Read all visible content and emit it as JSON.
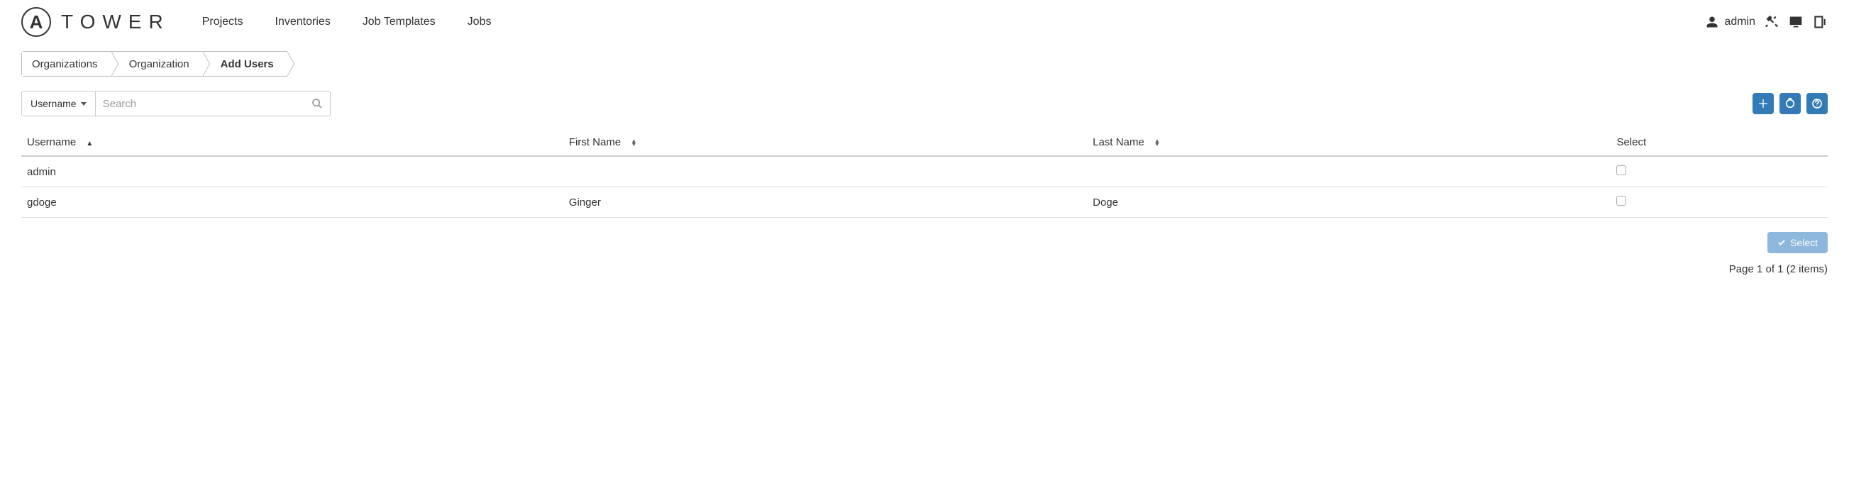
{
  "brand": {
    "logo_letter": "A",
    "name": "TOWER"
  },
  "nav": {
    "projects": "Projects",
    "inventories": "Inventories",
    "job_templates": "Job Templates",
    "jobs": "Jobs"
  },
  "user": {
    "name": "admin"
  },
  "breadcrumb": {
    "items": [
      "Organizations",
      "Organization",
      "Add Users"
    ]
  },
  "search": {
    "type_label": "Username",
    "placeholder": "Search"
  },
  "columns": {
    "username": "Username",
    "first_name": "First Name",
    "last_name": "Last Name",
    "select": "Select"
  },
  "rows": [
    {
      "username": "admin",
      "first_name": "",
      "last_name": ""
    },
    {
      "username": "gdoge",
      "first_name": "Ginger",
      "last_name": "Doge"
    }
  ],
  "footer": {
    "select_button": "Select",
    "pagination": "Page 1 of 1 (2 items)"
  }
}
